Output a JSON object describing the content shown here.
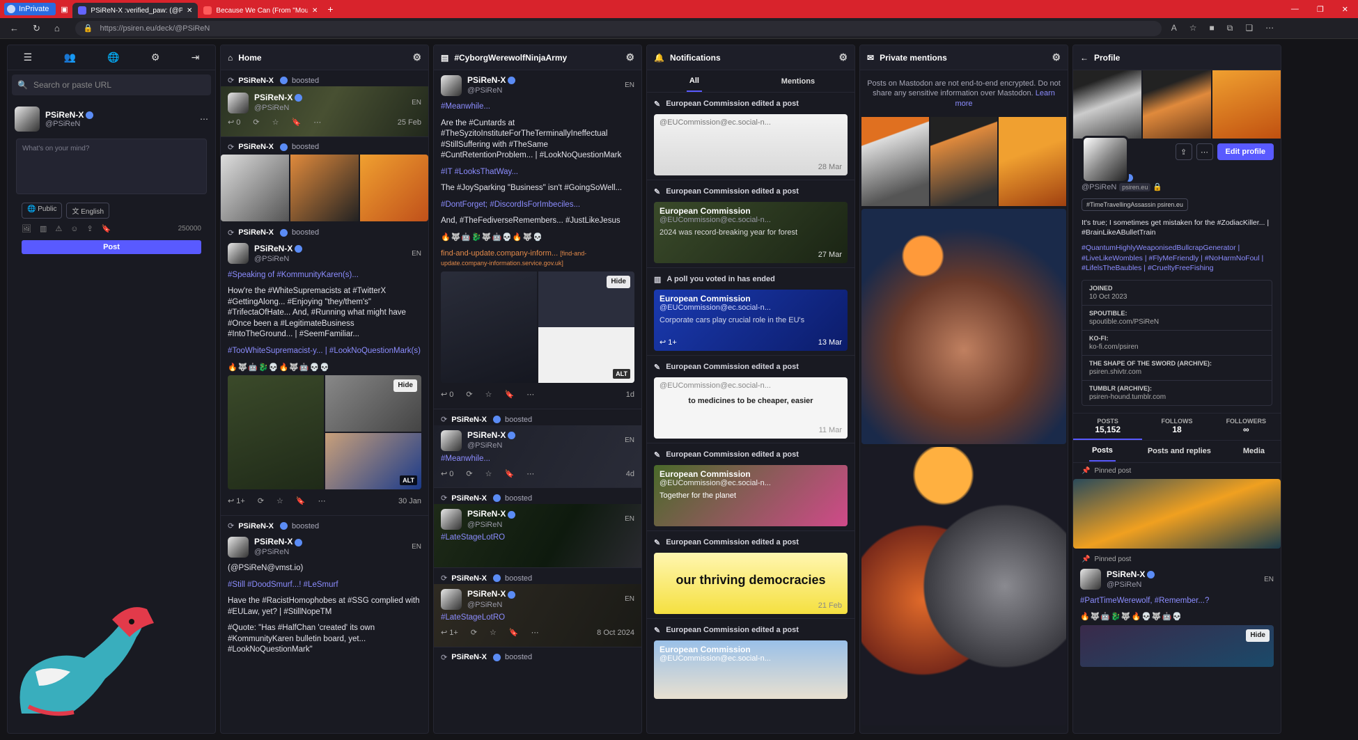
{
  "browser": {
    "inprivate": "InPrivate",
    "tabs": [
      {
        "title": "PSiReN-X :verified_paw: (@PSiReN...",
        "active": true
      },
      {
        "title": "Because We Can (From \"Moulin R...",
        "active": false
      }
    ],
    "url": "https://psiren.eu/deck/@PSiReN"
  },
  "left": {
    "search_placeholder": "Search or paste URL",
    "me": {
      "name": "PSiReN-X",
      "handle": "@PSiReN"
    },
    "compose_placeholder": "What's on your mind?",
    "visibility": "Public",
    "language": "English",
    "char_count": "250000",
    "post_label": "Post"
  },
  "home": {
    "title": "Home",
    "boosted": "boosted",
    "author": "PSiReN-X",
    "handle": "@PSiReN",
    "lang": "EN",
    "post1": {
      "time": "25 Feb",
      "reply": "0"
    },
    "post3": {
      "p1": "#Speaking of #KommunityKaren(s)...",
      "p2": "How're the #WhiteSupremacists at #TwitterX #GettingAlong... #Enjoying \"they/them's\" #TrifectaOfHate... And, #Running what might have #Once been a #LegitimateBusiness #IntoTheGround... | #SeemFamiliar...",
      "p3": "#TooWhiteSupremacist-y... | #LookNoQuestionMark(s)",
      "reply": "1+",
      "time": "30 Jan",
      "hide": "Hide",
      "alt": "ALT"
    },
    "post4": {
      "p1": "(@PSiReN@vmst.io)",
      "p2": "#Still #DoodSmurf...! #LeSmurf",
      "p3": "Have the #RacistHomophobes at #SSG complied with #EULaw, yet? | #StillNopeTM",
      "p4": "#Quote: \"Has #HalfChan 'created' its own #KommunityKaren bulletin board, yet... #LookNoQuestionMark\""
    }
  },
  "hashtag": {
    "title": "#CyborgWerewolfNinjaArmy",
    "author": "PSiReN-X",
    "handle": "@PSiReN",
    "lang": "EN",
    "boosted": "boosted",
    "post1": {
      "p1": "#Meanwhile...",
      "p2": "Are the #Cuntards at #TheSyzitoInstituteForTheTerminallyIneffectual #StillSuffering with #TheSame #CuntRetentionProblem... | #LookNoQuestionMark",
      "p3": "#IT #LooksThatWay...",
      "p4": "The #JoySparking \"Business\" isn't #GoingSoWell...",
      "p5": "#DontForget; #DiscordIsForImbeciles...",
      "p6": "And, #TheFediverseRemembers... #JustLikeJesus",
      "link": "find-and-update.company-inform...",
      "link_small": "[find-and-update.company-information.service.gov.uk]",
      "reply": "0",
      "time": "1d",
      "hide": "Hide",
      "alt": "ALT"
    },
    "post2": {
      "reply": "0",
      "time": "4d",
      "text": "#Meanwhile..."
    },
    "post3": {
      "text": "#LateStageLotRO"
    },
    "post4": {
      "text": "#LateStageLotRO",
      "reply": "1+",
      "time": "8 Oct 2024"
    }
  },
  "notifications": {
    "title": "Notifications",
    "tab_all": "All",
    "tab_mentions": "Mentions",
    "edited": "European Commission edited a post",
    "poll": "A poll you voted in has ended",
    "ec_name": "European Commission",
    "ec_handle": "@EUCommission@ec.social-n...",
    "items": [
      {
        "time": "28 Mar",
        "text": ""
      },
      {
        "time": "27 Mar",
        "text": "2024 was record-breaking year for forest"
      },
      {
        "time": "13 Mar",
        "text": "Corporate cars play crucial role in the EU's"
      },
      {
        "time": "11 Mar",
        "text": "to medicines to be cheaper, easier"
      },
      {
        "time": "",
        "text": "Together for the planet"
      },
      {
        "time": "21 Feb",
        "text": "our thriving democracies"
      },
      {
        "time": "",
        "text": ""
      }
    ],
    "reply": "1+"
  },
  "private": {
    "title": "Private mentions",
    "note": "Posts on Mastodon are not end-to-end encrypted. Do not share any sensitive information over Mastodon.",
    "learn_more": "Learn more"
  },
  "profile": {
    "title": "Profile",
    "edit_label": "Edit profile",
    "name": "PSiReN-X",
    "handle": "@PSiReN",
    "domain_pill": "psiren.eu",
    "badge": "#TimeTravellingAssassin psiren.eu",
    "bio1": "It's true; I sometimes get mistaken for the #ZodiacKiller... | #BrainLikeABulletTrain",
    "bio2": "#QuantumHighlyWeaponisedBullcrapGenerator | #LiveLikeWombles | #FlyMeFriendly | #NoHarmNoFoul | #LifelsTheBaubles | #CrueltyFreeFishing",
    "fields": [
      {
        "k": "JOINED",
        "v": "10 Oct 2023"
      },
      {
        "k": "SPOUTIBLE:",
        "v": "spoutible.com/PSiReN"
      },
      {
        "k": "KO-FI:",
        "v": "ko-fi.com/psiren"
      },
      {
        "k": "THE SHAPE OF THE SWORD (ARCHIVE):",
        "v": "psiren.shivtr.com"
      },
      {
        "k": "TUMBLR (ARCHIVE):",
        "v": "psiren-hound.tumblr.com"
      }
    ],
    "stats": [
      {
        "k": "POSTS",
        "v": "15,152"
      },
      {
        "k": "FOLLOWS",
        "v": "18"
      },
      {
        "k": "FOLLOWERS",
        "v": "∞"
      }
    ],
    "tabs": [
      "Posts",
      "Posts and replies",
      "Media"
    ],
    "pinned": "Pinned post",
    "post2_text": "#PartTimeWerewolf, #Remember...?",
    "lang": "EN",
    "hide": "Hide"
  }
}
